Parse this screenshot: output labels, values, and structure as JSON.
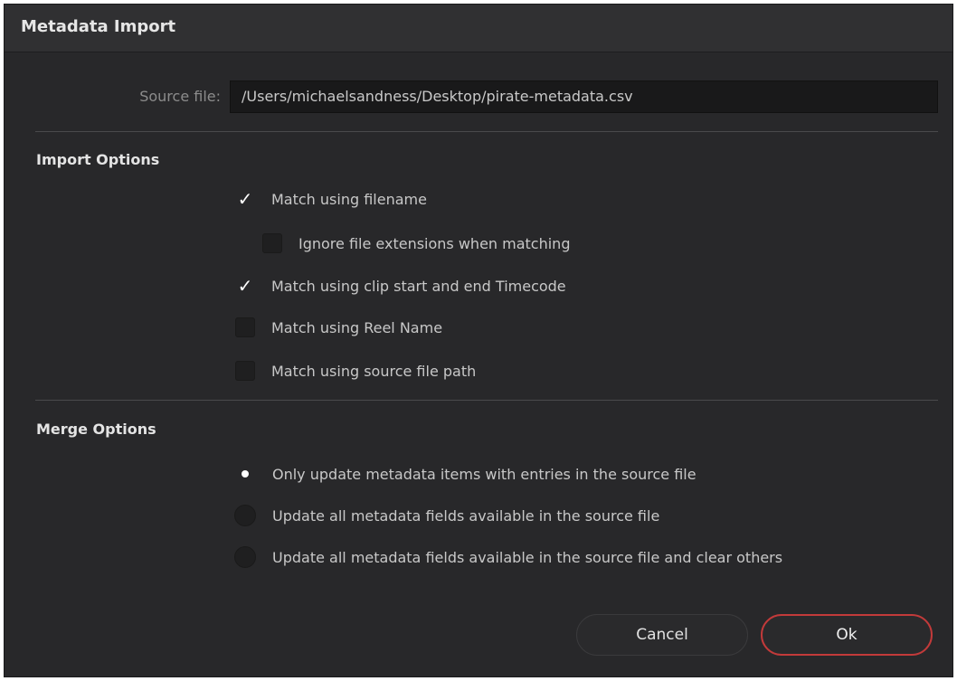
{
  "dialog": {
    "title": "Metadata Import",
    "source_label": "Source file:",
    "source_value": "/Users/michaelsandness/Desktop/pirate-metadata.csv"
  },
  "import_options": {
    "heading": "Import Options",
    "items": [
      {
        "label": "Match using filename",
        "checked": true
      },
      {
        "label": "Ignore file extensions when matching",
        "checked": false
      },
      {
        "label": "Match using clip start and end Timecode",
        "checked": true
      },
      {
        "label": "Match using Reel Name",
        "checked": false
      },
      {
        "label": "Match using source file path",
        "checked": false
      }
    ]
  },
  "merge_options": {
    "heading": "Merge Options",
    "items": [
      {
        "label": "Only update metadata items with entries in the source file",
        "selected": true
      },
      {
        "label": "Update all metadata fields available in the source file",
        "selected": false
      },
      {
        "label": "Update all metadata fields available in the source file and clear others",
        "selected": false
      }
    ]
  },
  "buttons": {
    "cancel": "Cancel",
    "ok": "Ok"
  },
  "colors": {
    "dialog_bg": "#28282a",
    "accent_ok_border": "#c23a3a"
  },
  "icons": {
    "check": "✓",
    "radio_dot": "●"
  }
}
